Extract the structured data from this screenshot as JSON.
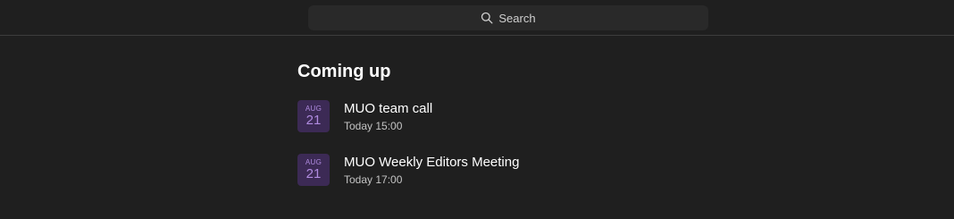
{
  "search": {
    "label": "Search"
  },
  "main": {
    "heading": "Coming up",
    "events": [
      {
        "month": "AUG",
        "day": "21",
        "title": "MUO team call",
        "time": "Today 15:00"
      },
      {
        "month": "AUG",
        "day": "21",
        "title": "MUO Weekly Editors Meeting",
        "time": "Today 17:00"
      }
    ]
  },
  "colors": {
    "background": "#1f1f1f",
    "search_background": "#292929",
    "divider": "#3d3d3d",
    "date_badge_background": "#3c2a55",
    "date_badge_text": "#b08be0",
    "secondary_text": "#c4c4c4"
  },
  "icons": {
    "search": "search-icon"
  }
}
